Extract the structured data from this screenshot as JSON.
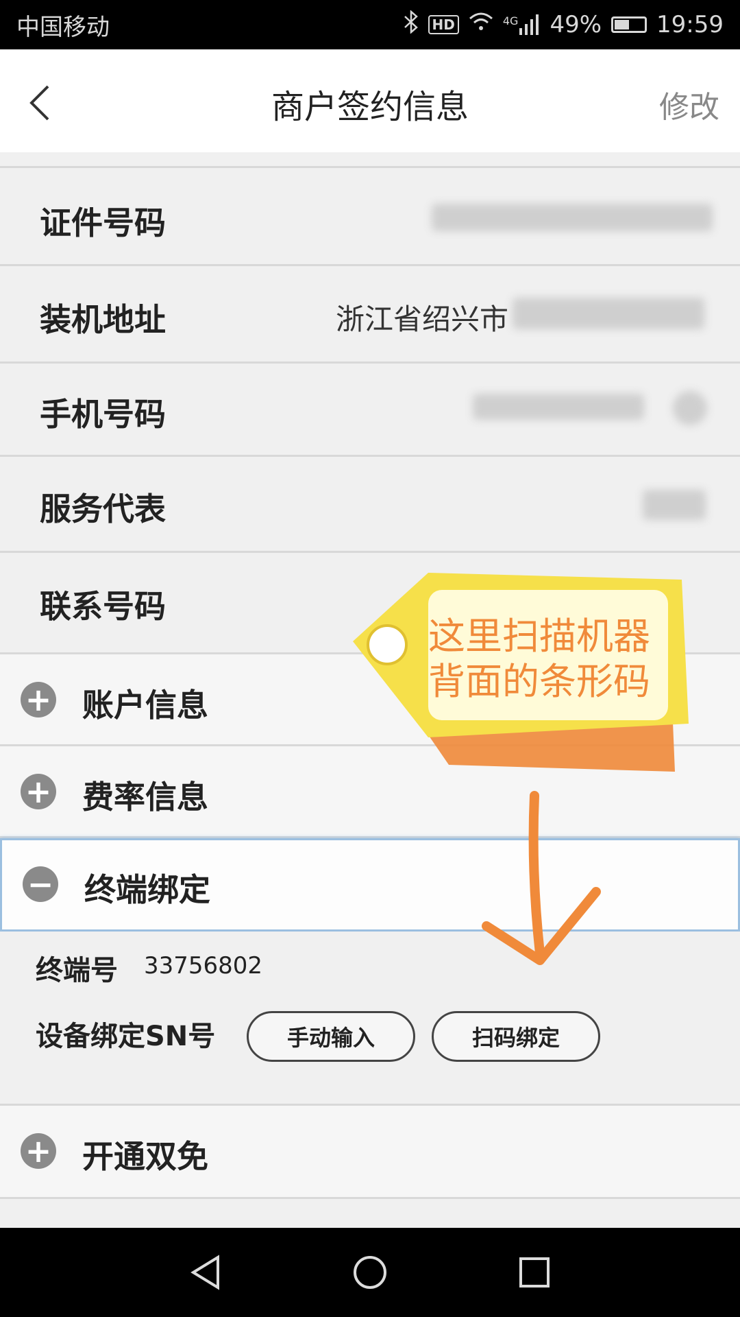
{
  "status_bar": {
    "carrier": "中国移动",
    "network": "4G",
    "battery_percent": "49%",
    "time": "19:59",
    "battery_level": 0.49,
    "icons": [
      "bluetooth-icon",
      "hd-icon",
      "wifi-icon",
      "signal-icon",
      "battery-icon"
    ]
  },
  "nav": {
    "title": "商户签约信息",
    "action": "修改",
    "back_icon": "chevron-left-icon"
  },
  "fields": [
    {
      "label": "证件号码",
      "value": ""
    },
    {
      "label": "装机地址",
      "value": "浙江省绍兴市"
    },
    {
      "label": "手机号码",
      "value": ""
    },
    {
      "label": "服务代表",
      "value": ""
    },
    {
      "label": "联系号码",
      "value": ""
    }
  ],
  "sections": {
    "account": {
      "label": "账户信息",
      "icon": "plus-circle-icon"
    },
    "rate": {
      "label": "费率信息",
      "icon": "plus-circle-icon"
    },
    "terminal": {
      "label": "终端绑定",
      "icon": "minus-circle-icon"
    },
    "dual_free": {
      "label": "开通双免",
      "icon": "plus-circle-icon"
    }
  },
  "terminal": {
    "number_label": "终端号",
    "number_value": "33756802",
    "sn_label": "设备绑定SN号",
    "manual_button": "手动输入",
    "scan_button": "扫码绑定"
  },
  "annotation": {
    "text_line1": "这里扫描机器",
    "text_line2": "背面的条形码"
  },
  "colors": {
    "accent_orange": "#f08a3a",
    "tag_yellow": "#f6e04a",
    "active_border": "#9bbfe0"
  }
}
